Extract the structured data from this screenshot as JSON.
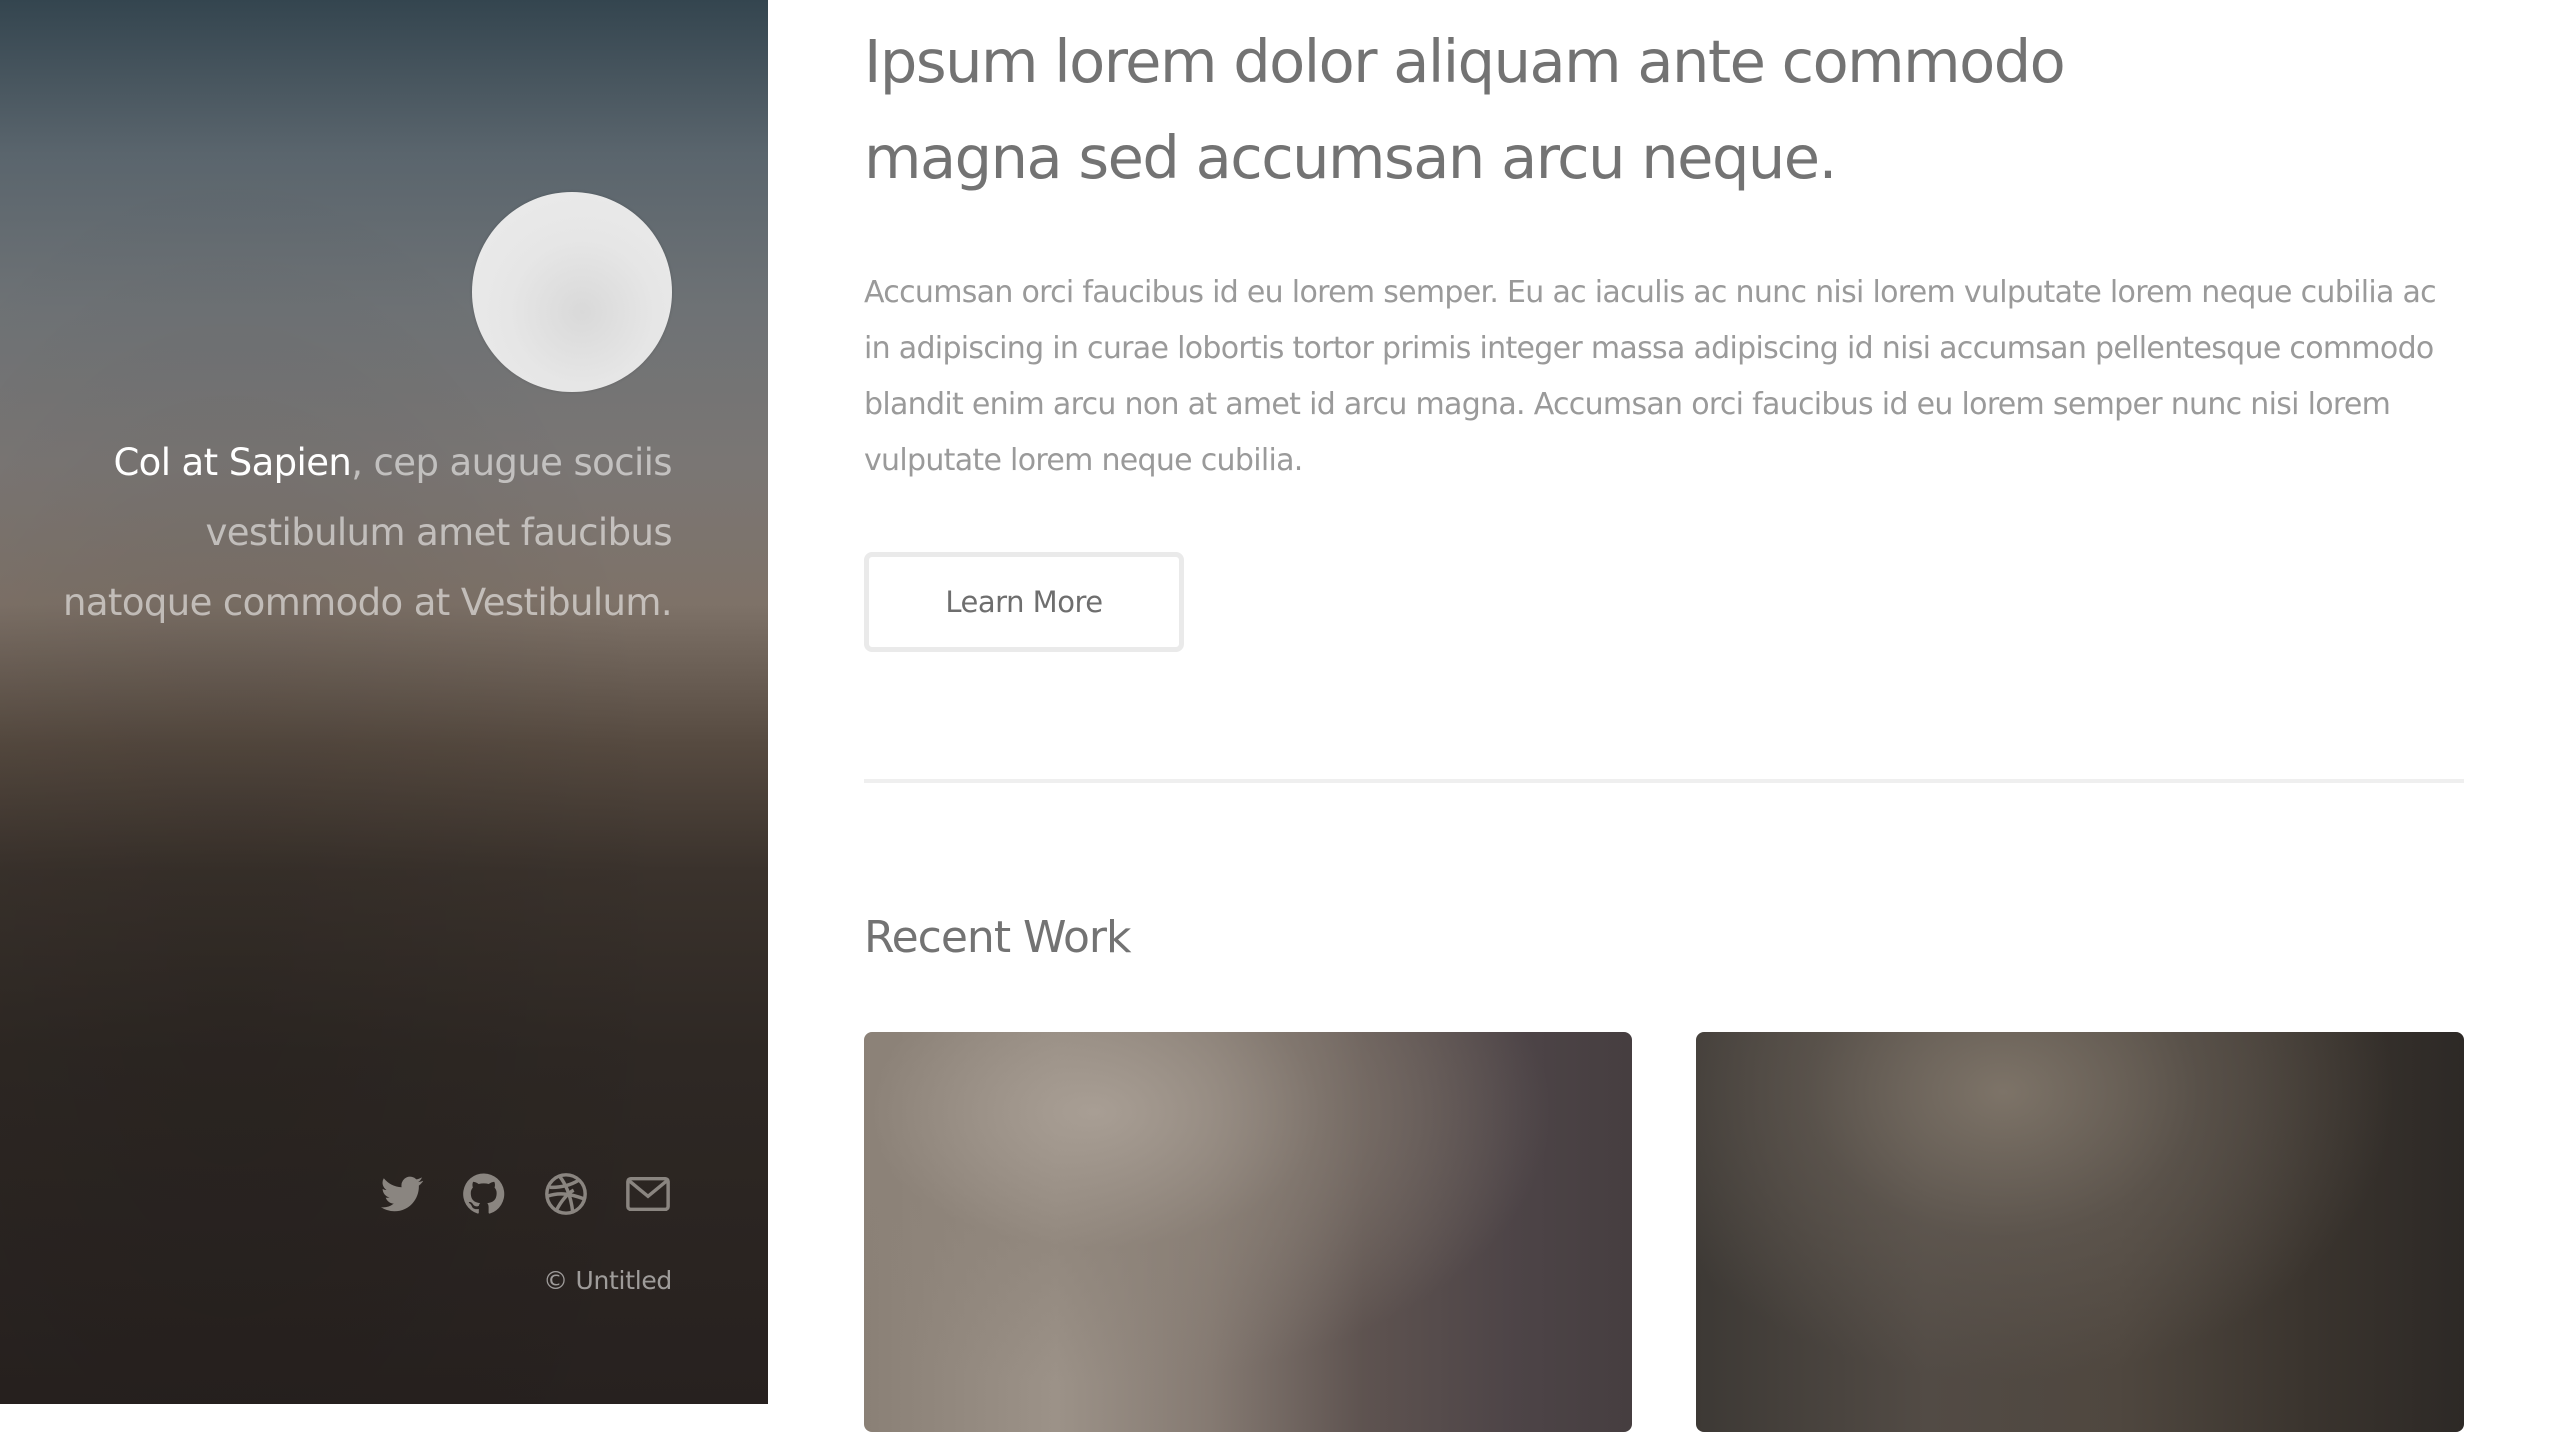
{
  "sidebar": {
    "intro_strong": "Col at Sapien",
    "intro_rest": ", cep augue sociis vestibulum amet faucibus natoque commodo at Vestibulum.",
    "social": [
      {
        "icon": "twitter-icon"
      },
      {
        "icon": "github-icon"
      },
      {
        "icon": "dribbble-icon"
      },
      {
        "icon": "envelope-icon"
      }
    ],
    "copyright": "© Untitled"
  },
  "main": {
    "headline": "Ipsum lorem dolor aliquam ante commodo magna sed accumsan arcu neque.",
    "lead": "Accumsan orci faucibus id eu lorem semper. Eu ac iaculis ac nunc nisi lorem vulputate lorem neque cubilia ac in adipiscing in curae lobortis tortor primis integer massa adipiscing id nisi accumsan pellentesque commodo blandit enim arcu non at amet id arcu magna. Accumsan orci faucibus id eu lorem semper nunc nisi lorem vulputate lorem neque cubilia.",
    "learn_more": "Learn More",
    "recent_work_title": "Recent Work"
  },
  "colors": {
    "text_heading": "#737373",
    "text_body": "#9a9a9a",
    "button_border": "#eaeaea",
    "divider": "#efefef"
  }
}
